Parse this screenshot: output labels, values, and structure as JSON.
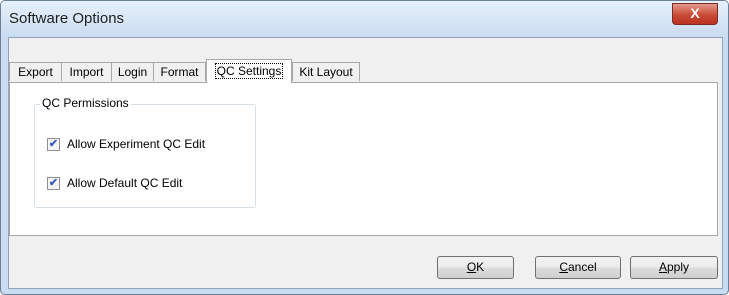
{
  "window": {
    "title": "Software Options",
    "close_label": "X"
  },
  "tabs": [
    {
      "label": "Export"
    },
    {
      "label": "Import"
    },
    {
      "label": "Login"
    },
    {
      "label": "Format"
    },
    {
      "label": "QC Settings",
      "active": true
    },
    {
      "label": "Kit Layout"
    }
  ],
  "qc_permissions": {
    "legend": "QC Permissions",
    "items": [
      {
        "label": "Allow Experiment QC Edit",
        "checked": true
      },
      {
        "label": "Allow Default QC Edit",
        "checked": true
      }
    ]
  },
  "buttons": {
    "ok": {
      "accel": "O",
      "rest": "K"
    },
    "cancel": {
      "accel": "C",
      "rest": "ancel"
    },
    "apply": {
      "accel": "A",
      "rest": "pply"
    }
  },
  "colors": {
    "accent": "#3b5cb8",
    "close_button": "#c94a35"
  }
}
